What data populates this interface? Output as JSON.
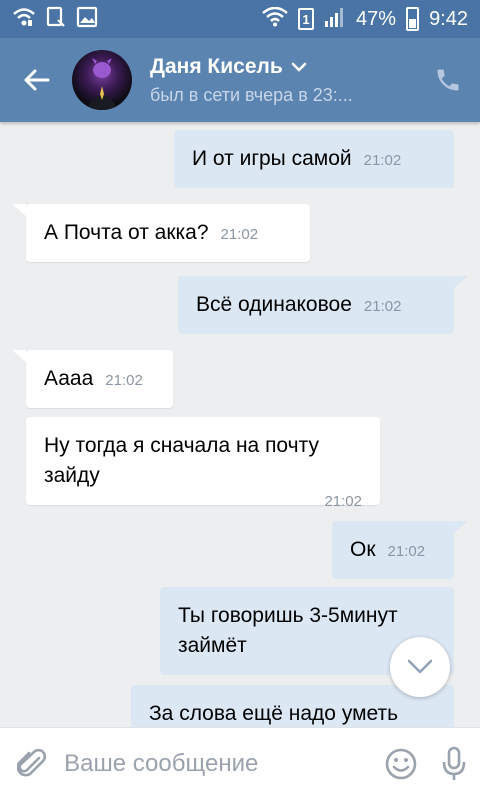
{
  "status_bar": {
    "battery_percent": "47%",
    "battery_level": 0.47,
    "sim_number": "1",
    "time": "9:42",
    "icons": [
      "wifi-calling-icon",
      "device-icon",
      "image-icon",
      "wifi-icon",
      "sim-icon",
      "signal-icon",
      "battery-icon"
    ]
  },
  "header": {
    "name": "Даня Кисель",
    "status": "был в сети вчера в 23:...",
    "icons": [
      "back-arrow-icon",
      "chevron-down-icon",
      "phone-icon"
    ]
  },
  "messages": [
    {
      "direction": "out",
      "text": "И от игры самой",
      "time": "21:02"
    },
    {
      "direction": "in",
      "text": "А Почта от акка?",
      "time": "21:02"
    },
    {
      "direction": "out",
      "text": "Всё одинаковое",
      "time": "21:02"
    },
    {
      "direction": "in",
      "text": "Аааа",
      "time": "21:02"
    },
    {
      "direction": "in",
      "text": "Ну тогда я сначала на почту зайду",
      "time": "21:02"
    },
    {
      "direction": "out",
      "text": "Ок",
      "time": "21:02"
    },
    {
      "direction": "out",
      "text": "Ты говоришь 3-5минут займёт",
      "time": ""
    },
    {
      "direction": "out",
      "text": "За слова ещё надо уметь",
      "time": ""
    }
  ],
  "composer": {
    "placeholder": "Ваше сообщение",
    "value": "",
    "icons": [
      "paperclip-icon",
      "smiley-icon",
      "microphone-icon"
    ]
  },
  "colors": {
    "status_bar": "#4a74a5",
    "header": "#5b84b1",
    "background": "#edeef0",
    "outgoing_bubble": "#dce7f4",
    "incoming_bubble": "#ffffff"
  }
}
